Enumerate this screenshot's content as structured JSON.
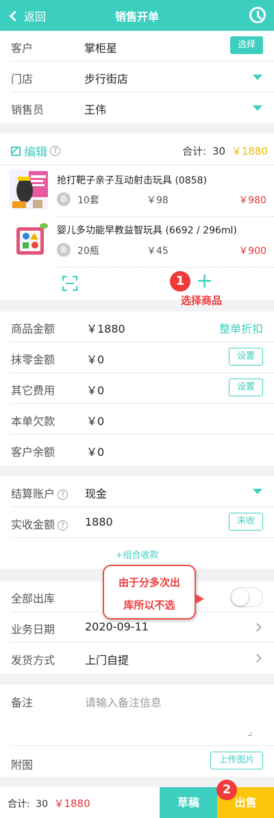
{
  "header": {
    "back_label": "返回",
    "title": "销售开单"
  },
  "customer": {
    "label": "客户",
    "value": "掌柜星",
    "select_label": "选择"
  },
  "store": {
    "label": "门店",
    "value": "步行街店"
  },
  "salesperson": {
    "label": "销售员",
    "value": "王伟"
  },
  "cart": {
    "edit_label": "编辑",
    "total_label": "合计:",
    "total_count": "30",
    "total_amount": "￥1880",
    "items": [
      {
        "name": "抢打靶子亲子互动射击玩具 (0858)",
        "tag": "备",
        "qty": "10套",
        "price": "￥98",
        "subtotal": "￥980"
      },
      {
        "name": "婴儿多功能早教益智玩具 (6692 / 296ml)",
        "tag": "备",
        "qty": "20瓶",
        "price": "￥45",
        "subtotal": "￥900"
      }
    ],
    "add_plus": "+"
  },
  "amounts": {
    "goods_label": "商品金额",
    "goods_value": "￥1880",
    "discount_label": "整单折扣",
    "round_label": "抹零金额",
    "round_value": "￥0",
    "round_btn": "设置",
    "other_label": "其它费用",
    "other_value": "￥0",
    "other_btn": "设置",
    "debt_label": "本单欠款",
    "debt_value": "￥0",
    "balance_label": "客户余额",
    "balance_value": "￥0"
  },
  "settlement": {
    "account_label": "结算账户",
    "account_value": "现金",
    "received_label": "实收金额",
    "received_value": "1880",
    "received_btn": "未收",
    "combo_label": "+组合收款"
  },
  "shipping": {
    "all_out_label": "全部出库",
    "date_label": "业务日期",
    "date_value": "2020-09-11",
    "method_label": "发货方式",
    "method_value": "上门自提"
  },
  "remarks": {
    "label": "备注",
    "placeholder": "请输入备注信息",
    "attach_label": "附图",
    "upload_btn": "上传图片"
  },
  "footer": {
    "total_label": "合计:",
    "total_count": "30",
    "total_amount": "￥1880",
    "draft_label": "草稿",
    "sell_label": "出售"
  },
  "annotations": {
    "badge1": "1",
    "badge1_text": "选择商品",
    "badge2": "2",
    "bubble_line1": "由于分多次出",
    "bubble_line2": "库所以不选"
  },
  "colors": {
    "accent": "#3ccfc0",
    "price_red": "#e83030",
    "total_yellow": "#f5b800",
    "sell_yellow": "#fdc50a",
    "annotation_red": "#ee3a3a"
  }
}
